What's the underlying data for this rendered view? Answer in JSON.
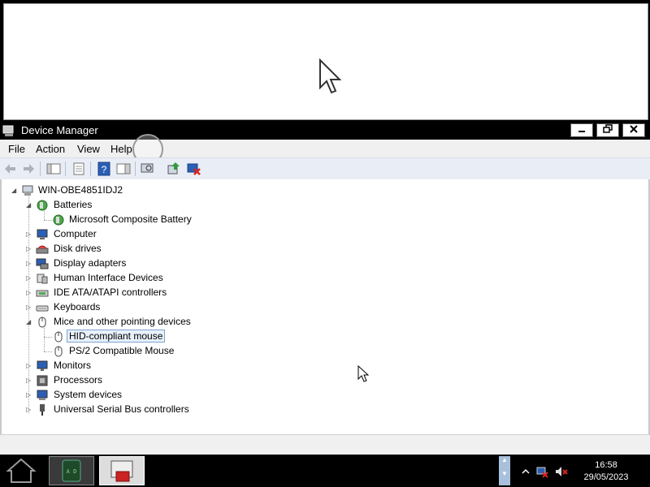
{
  "window": {
    "title": "Device Manager",
    "buttons": [
      "minimize",
      "restore",
      "close"
    ]
  },
  "menu": [
    "File",
    "Action",
    "View",
    "Help"
  ],
  "toolbar": {
    "icons": [
      "back-icon",
      "forward-icon",
      "show-hide-console-tree-icon",
      "properties-icon",
      "help-icon",
      "action-pane-icon",
      "scan-hardware-icon",
      "update-driver-icon",
      "uninstall-icon"
    ]
  },
  "tree": {
    "root": "WIN-OBE4851IDJ2",
    "nodes": [
      {
        "label": "Batteries",
        "level": 1,
        "expanded": true,
        "icon": "battery-icon"
      },
      {
        "label": "Microsoft Composite Battery",
        "level": 2,
        "icon": "battery-icon"
      },
      {
        "label": "Computer",
        "level": 1,
        "icon": "computer-icon"
      },
      {
        "label": "Disk drives",
        "level": 1,
        "icon": "disk-drive-icon"
      },
      {
        "label": "Display adapters",
        "level": 1,
        "icon": "display-adapter-icon"
      },
      {
        "label": "Human Interface Devices",
        "level": 1,
        "icon": "hid-icon"
      },
      {
        "label": "IDE ATA/ATAPI controllers",
        "level": 1,
        "icon": "ide-controller-icon"
      },
      {
        "label": "Keyboards",
        "level": 1,
        "icon": "keyboard-icon"
      },
      {
        "label": "Mice and other pointing devices",
        "level": 1,
        "expanded": true,
        "icon": "mouse-icon"
      },
      {
        "label": "HID-compliant mouse",
        "level": 2,
        "selected": true,
        "icon": "mouse-icon"
      },
      {
        "label": "PS/2 Compatible Mouse",
        "level": 2,
        "icon": "mouse-icon"
      },
      {
        "label": "Monitors",
        "level": 1,
        "icon": "monitor-icon"
      },
      {
        "label": "Processors",
        "level": 1,
        "icon": "processor-icon"
      },
      {
        "label": "System devices",
        "level": 1,
        "icon": "system-devices-icon"
      },
      {
        "label": "Universal Serial Bus controllers",
        "level": 1,
        "icon": "usb-icon"
      }
    ]
  },
  "taskbar": {
    "time": "16:58",
    "date": "29/05/2023"
  },
  "colors": {
    "accent": "#3a78c9",
    "selection_border": "#7da2ce",
    "selection_bg": "#e8f1fb"
  }
}
